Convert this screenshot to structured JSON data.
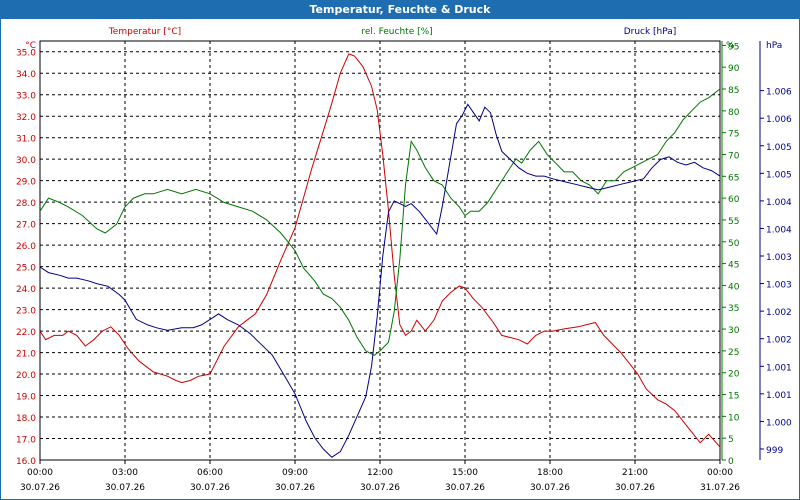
{
  "window": {
    "title": "Temperatur, Feuchte & Druck"
  },
  "colors": {
    "temperature": "#cc0000",
    "humidity": "#007700",
    "pressure": "#00008b",
    "titlebar": "#1e6db0",
    "grid": "#000000"
  },
  "chart_data": {
    "type": "line",
    "title": "Temperatur, Feuchte & Druck",
    "grid": true,
    "x_ticks": [
      {
        "time": "00:00",
        "date": "30.07.26"
      },
      {
        "time": "03:00",
        "date": "30.07.26"
      },
      {
        "time": "06:00",
        "date": "30.07.26"
      },
      {
        "time": "09:00",
        "date": "30.07.26"
      },
      {
        "time": "12:00",
        "date": "30.07.26"
      },
      {
        "time": "15:00",
        "date": "30.07.26"
      },
      {
        "time": "18:00",
        "date": "30.07.26"
      },
      {
        "time": "21:00",
        "date": "30.07.26"
      },
      {
        "time": "00:00",
        "date": "31.07.26"
      }
    ],
    "x_unit": "hours",
    "axes": {
      "temperature": {
        "unit": "°C",
        "label": "Temperatur [°C]",
        "side": "left",
        "ylim": [
          16.0,
          35.5
        ],
        "ticks": [
          "16.0",
          "17.0",
          "18.0",
          "19.0",
          "20.0",
          "21.0",
          "22.0",
          "23.0",
          "24.0",
          "25.0",
          "26.0",
          "27.0",
          "28.0",
          "29.0",
          "30.0",
          "31.0",
          "32.0",
          "33.0",
          "34.0",
          "35.0"
        ]
      },
      "humidity": {
        "unit": "%",
        "label": "rel. Feuchte [%]",
        "side": "right",
        "ylim": [
          0,
          96
        ],
        "ticks": [
          "0",
          "5",
          "10",
          "15",
          "20",
          "25",
          "30",
          "35",
          "40",
          "45",
          "50",
          "55",
          "60",
          "65",
          "70",
          "75",
          "80",
          "85",
          "90",
          "95",
          "%"
        ]
      },
      "pressure": {
        "unit": "hPa",
        "label": "Druck [hPa]",
        "side": "right",
        "ylim": [
          998.8,
          1006.4
        ],
        "ticks": [
          {
            "v": 999.0,
            "t": "999"
          },
          {
            "v": 999.5,
            "t": "1.000"
          },
          {
            "v": 1000.0,
            "t": "1.001"
          },
          {
            "v": 1000.5,
            "t": "1.001"
          },
          {
            "v": 1001.0,
            "t": "1.002"
          },
          {
            "v": 1001.5,
            "t": "1.002"
          },
          {
            "v": 1002.0,
            "t": "1.003"
          },
          {
            "v": 1002.5,
            "t": "1.003"
          },
          {
            "v": 1003.0,
            "t": "1.004"
          },
          {
            "v": 1003.5,
            "t": "1.004"
          },
          {
            "v": 1004.0,
            "t": "1.005"
          },
          {
            "v": 1004.5,
            "t": "1.005"
          },
          {
            "v": 1005.0,
            "t": "1.006"
          },
          {
            "v": 1005.5,
            "t": "1.006"
          }
        ]
      }
    },
    "series": [
      {
        "name": "Temperatur [°C]",
        "axis": "temperature",
        "x": [
          0,
          0.2,
          0.5,
          0.8,
          1,
          1.3,
          1.6,
          1.9,
          2.2,
          2.5,
          2.8,
          3.1,
          3.5,
          4,
          4.5,
          4.8,
          5,
          5.3,
          5.6,
          6,
          6.5,
          7,
          7.3,
          7.6,
          8,
          8.5,
          9,
          9.3,
          9.6,
          10,
          10.3,
          10.6,
          10.9,
          11.1,
          11.4,
          11.7,
          11.9,
          12.1,
          12.3,
          12.5,
          12.7,
          12.9,
          13.1,
          13.3,
          13.6,
          13.9,
          14.2,
          14.5,
          14.8,
          15,
          15.3,
          15.6,
          16,
          16.3,
          16.6,
          16.9,
          17.2,
          17.5,
          17.8,
          18.1,
          18.5,
          19,
          19.3,
          19.6,
          19.9,
          20.2,
          20.5,
          20.8,
          21.1,
          21.4,
          21.8,
          22.1,
          22.4,
          22.7,
          23,
          23.3,
          23.6,
          24
        ],
        "values": [
          22.0,
          21.6,
          21.8,
          21.8,
          22.0,
          21.8,
          21.3,
          21.6,
          22.0,
          22.2,
          21.8,
          21.2,
          20.6,
          20.1,
          19.9,
          19.7,
          19.6,
          19.7,
          19.9,
          20.0,
          21.3,
          22.2,
          22.5,
          22.8,
          23.7,
          25.3,
          26.8,
          28.2,
          29.6,
          31.3,
          32.6,
          34.0,
          34.9,
          34.8,
          34.3,
          33.4,
          32.3,
          30.2,
          27.6,
          24.6,
          22.3,
          21.8,
          22.0,
          22.5,
          22.0,
          22.5,
          23.4,
          23.8,
          24.1,
          24.0,
          23.5,
          23.1,
          22.4,
          21.8,
          21.7,
          21.6,
          21.4,
          21.8,
          22.0,
          22.0,
          22.1,
          22.2,
          22.3,
          22.4,
          21.8,
          21.4,
          21.0,
          20.5,
          20.0,
          19.3,
          18.8,
          18.6,
          18.3,
          17.8,
          17.3,
          16.8,
          17.2,
          16.6
        ]
      },
      {
        "name": "rel. Feuchte [%]",
        "axis": "humidity",
        "x": [
          0,
          0.3,
          0.7,
          1,
          1.5,
          2,
          2.3,
          2.7,
          3,
          3.3,
          3.7,
          4,
          4.5,
          5,
          5.5,
          6,
          6.5,
          7,
          7.5,
          8,
          8.5,
          9,
          9.3,
          9.7,
          10,
          10.3,
          10.6,
          10.9,
          11.2,
          11.5,
          11.8,
          12,
          12.3,
          12.5,
          12.7,
          12.9,
          13.1,
          13.3,
          13.6,
          13.9,
          14.2,
          14.5,
          14.8,
          15,
          15.2,
          15.5,
          15.8,
          16,
          16.2,
          16.5,
          16.8,
          17,
          17.3,
          17.6,
          17.9,
          18.2,
          18.5,
          18.8,
          19.1,
          19.4,
          19.7,
          20,
          20.3,
          20.6,
          20.9,
          21.2,
          21.5,
          21.8,
          22.1,
          22.4,
          22.7,
          23,
          23.3,
          23.6,
          24
        ],
        "values": [
          57,
          60,
          59,
          58,
          56,
          53,
          52,
          54,
          58,
          60,
          61,
          61,
          62,
          61,
          62,
          61,
          59,
          58,
          57,
          55,
          52,
          48,
          44,
          41,
          38,
          37,
          35,
          32,
          28,
          25,
          24,
          25,
          27,
          34,
          46,
          63,
          73,
          71,
          67,
          64,
          63,
          60,
          58,
          56,
          57,
          57,
          59,
          61,
          63,
          66,
          69,
          68,
          71,
          73,
          70,
          68,
          66,
          66,
          64,
          63,
          61,
          64,
          64,
          66,
          67,
          68,
          69,
          70,
          73,
          75,
          78,
          80,
          82,
          83,
          85
        ],
        "note": "approximate series read off the chart"
      },
      {
        "name": "Druck [hPa]",
        "axis": "pressure",
        "x": [
          0,
          0.3,
          0.7,
          1,
          1.3,
          1.7,
          2,
          2.4,
          2.8,
          3,
          3.4,
          3.8,
          4.1,
          4.5,
          5,
          5.4,
          5.7,
          6,
          6.3,
          6.6,
          7,
          7.4,
          7.8,
          8.2,
          8.6,
          9,
          9.4,
          9.7,
          10,
          10.3,
          10.6,
          10.9,
          11.2,
          11.5,
          11.7,
          11.9,
          12.1,
          12.3,
          12.5,
          12.7,
          12.9,
          13.1,
          13.4,
          13.7,
          14,
          14.2,
          14.5,
          14.7,
          14.9,
          15.1,
          15.3,
          15.5,
          15.7,
          15.9,
          16.1,
          16.3,
          16.6,
          16.9,
          17.2,
          17.5,
          17.8,
          18.1,
          18.5,
          18.9,
          19.3,
          19.7,
          20.1,
          20.5,
          20.9,
          21.3,
          21.6,
          21.9,
          22.2,
          22.5,
          22.8,
          23.1,
          23.4,
          23.7,
          24
        ],
        "values": [
          1002.3,
          1002.2,
          1002.15,
          1002.1,
          1002.1,
          1002.05,
          1002.0,
          1001.95,
          1001.8,
          1001.7,
          1001.35,
          1001.25,
          1001.2,
          1001.15,
          1001.2,
          1001.2,
          1001.25,
          1001.35,
          1001.45,
          1001.35,
          1001.25,
          1001.1,
          1000.9,
          1000.7,
          1000.35,
          1000.0,
          999.5,
          999.2,
          999.0,
          998.85,
          998.95,
          999.25,
          999.6,
          999.95,
          1000.5,
          1001.4,
          1002.5,
          1003.3,
          1003.5,
          1003.45,
          1003.4,
          1003.45,
          1003.3,
          1003.1,
          1002.9,
          1003.4,
          1004.3,
          1004.9,
          1005.05,
          1005.25,
          1005.1,
          1004.95,
          1005.2,
          1005.1,
          1004.7,
          1004.4,
          1004.25,
          1004.1,
          1004.0,
          1003.95,
          1003.95,
          1003.9,
          1003.85,
          1003.8,
          1003.75,
          1003.7,
          1003.75,
          1003.8,
          1003.85,
          1003.9,
          1004.1,
          1004.25,
          1004.3,
          1004.2,
          1004.15,
          1004.2,
          1004.1,
          1004.05,
          1003.95
        ],
        "note": "approximate series read off the chart"
      }
    ]
  }
}
